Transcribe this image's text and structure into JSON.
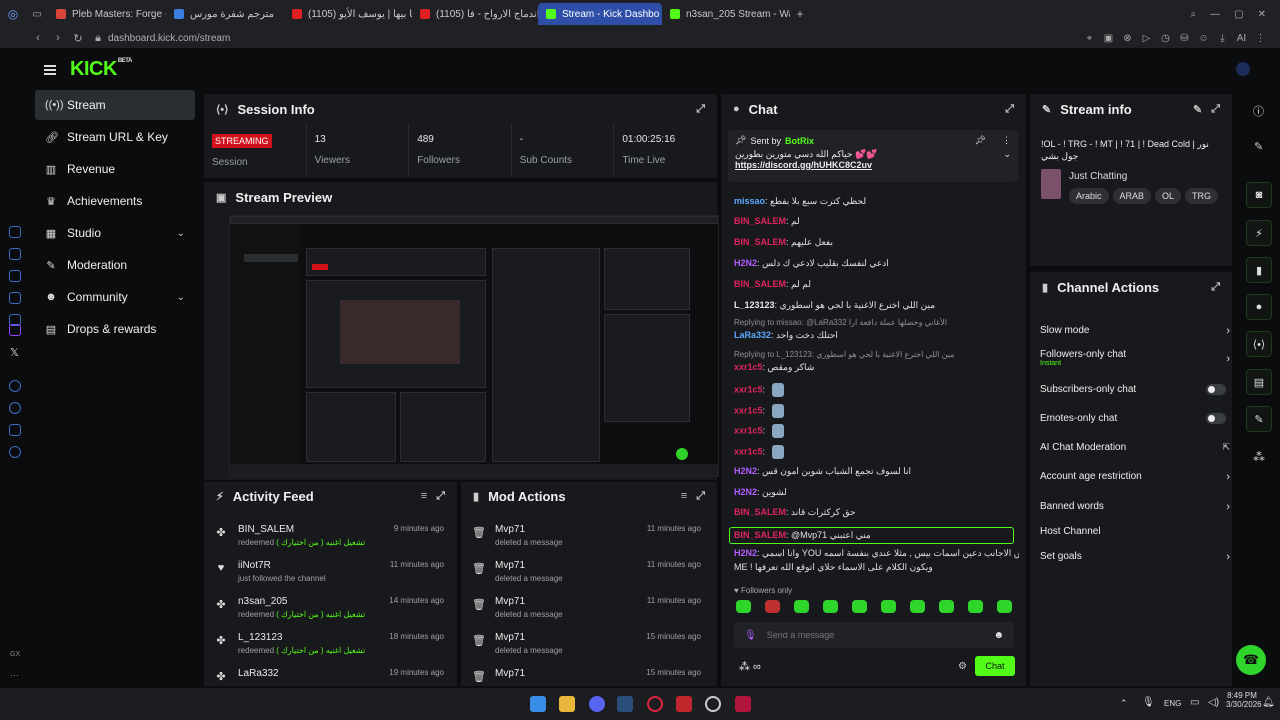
{
  "browser": {
    "tabs": [
      {
        "label": "Pleb Masters: Forge - GTA",
        "fav": "#d6453a"
      },
      {
        "label": "مترجم شفرة مورس",
        "fav": "#3b7de0"
      },
      {
        "label": "(1105) أرحتا بيها | يوسف الأيو...",
        "fav": "#e02020"
      },
      {
        "label": "(1105) اندماج الارواح - فا...",
        "fav": "#e02020"
      },
      {
        "label": "Stream - Kick Dashbo",
        "fav": "#53fc18"
      },
      {
        "label": "n3san_205 Stream - Watc",
        "fav": "#53fc18"
      }
    ],
    "url": "dashboard.kick.com/stream",
    "ai_label": "AI"
  },
  "brand": {
    "logo": "KICK",
    "beta": "BETA"
  },
  "sidebar": {
    "items": [
      {
        "label": "Stream",
        "icon": "broadcast-icon"
      },
      {
        "label": "Stream URL & Key",
        "icon": "link-icon"
      },
      {
        "label": "Revenue",
        "icon": "chart-icon"
      },
      {
        "label": "Achievements",
        "icon": "trophy-icon"
      },
      {
        "label": "Studio",
        "icon": "studio-icon"
      },
      {
        "label": "Moderation",
        "icon": "wrench-icon"
      },
      {
        "label": "Community",
        "icon": "people-icon"
      },
      {
        "label": "Drops & rewards",
        "icon": "gift-icon"
      }
    ]
  },
  "session": {
    "title": "Session Info",
    "status": "STREAMING",
    "status_label": "Session",
    "viewers": "13",
    "viewers_label": "Viewers",
    "followers": "489",
    "followers_label": "Followers",
    "subs": "-",
    "subs_label": "Sub Counts",
    "time": "01:00:25:16",
    "time_label": "Time Live"
  },
  "preview": {
    "title": "Stream Preview"
  },
  "activity": {
    "title": "Activity Feed",
    "rows": [
      {
        "name": "BIN_SALEM",
        "desc": "redeemed",
        "reward": "تشغيل اغنيه ( من اختيارك )",
        "time": "9 minutes ago"
      },
      {
        "name": "iiNot7R",
        "desc": "just followed the channel",
        "reward": "",
        "time": "11 minutes ago"
      },
      {
        "name": "n3san_205",
        "desc": "redeemed",
        "reward": "تشغيل اغنيه ( من اختيارك )",
        "time": "14 minutes ago"
      },
      {
        "name": "L_123123",
        "desc": "redeemed",
        "reward": "تشغيل اغنيه ( من اختيارك )",
        "time": "18 minutes ago"
      },
      {
        "name": "LaRa332",
        "desc": "",
        "reward": "",
        "time": "19 minutes ago"
      }
    ]
  },
  "mod": {
    "title": "Mod Actions",
    "rows": [
      {
        "name": "Mvp71",
        "desc": "deleted a message",
        "time": "11 minutes ago"
      },
      {
        "name": "Mvp71",
        "desc": "deleted a message",
        "time": "11 minutes ago"
      },
      {
        "name": "Mvp71",
        "desc": "deleted a message",
        "time": "11 minutes ago"
      },
      {
        "name": "Mvp71",
        "desc": "deleted a message",
        "time": "15 minutes ago"
      },
      {
        "name": "Mvp71",
        "desc": "",
        "time": "15 minutes ago"
      }
    ]
  },
  "chat": {
    "title": "Chat",
    "pinned_by": "Sent by",
    "pinned_user": "BotRix",
    "pinned_text": "حياكم الله دسي متورين بطورين 💕💕",
    "pinned_link": "https://discord.gg/hUHKC8C2uv",
    "messages": [
      {
        "user": "missao",
        "color": "#5aa9ff",
        "text": "لحظي كترت سبع بلا بفطع"
      },
      {
        "user": "BIN_SALEM",
        "color": "#e0245e",
        "text": "لم"
      },
      {
        "user": "BIN_SALEM",
        "color": "#e0245e",
        "text": "بفعل عليهم"
      },
      {
        "user": "H2N2",
        "color": "#b05cff",
        "text": "ادعي لنفسك بقليب لادعي ك دلس"
      },
      {
        "user": "BIN_SALEM",
        "color": "#e0245e",
        "text": "لم لم"
      },
      {
        "user": "L_123123",
        "color": "#e8e8e8",
        "text": "مين اللي اخترع الاغنية با لحي هو اسطوري"
      },
      {
        "reply": "Replying to missao: @LaRa332 الأغاني وخضلها عملة دافعة ارا"
      },
      {
        "user": "LaRa332",
        "color": "#5aa9ff",
        "text": "احتلك دخت واحد"
      },
      {
        "reply": "Replying to L_123123: مين اللي اخترع الاغنية با لحي هو اسطوري"
      },
      {
        "user": "xxr1c5",
        "color": "#e0245e",
        "text": "شاكر ومقص"
      },
      {
        "user": "xxr1c5",
        "color": "#e0245e",
        "text": ""
      },
      {
        "user": "xxr1c5",
        "color": "#e0245e",
        "text": ""
      },
      {
        "user": "xxr1c5",
        "color": "#e0245e",
        "text": ""
      },
      {
        "user": "xxr1c5",
        "color": "#e0245e",
        "text": ""
      },
      {
        "user": "H2N2",
        "color": "#b05cff",
        "text": "انا لسوف تجمع الشباب شوين امون قس"
      },
      {
        "user": "H2N2",
        "color": "#b05cff",
        "text": "لشوين"
      },
      {
        "user": "BIN_SALEM",
        "color": "#e0245e",
        "text": "حق كركثرات قاند"
      },
      {
        "user": "BIN_SALEM",
        "color": "#e0245e",
        "text": "@Mvp71 مني اعتبني"
      },
      {
        "user": "H2N2",
        "color": "#b05cff",
        "text": "وانا اسمي YOU شيون نفس الاجانب دعين اسمات بيس , مثلا عندي بنفسة اسمه"
      },
      {
        "user": "",
        "color": "#e8e8e8",
        "text": "ME ! ويكون الكلام على الاسماء حلاي اتوقع الله تعرفها"
      }
    ],
    "followers_only": "Followers only",
    "placeholder": "Send a message",
    "send": "Chat"
  },
  "stream_info": {
    "title": "Stream info",
    "stream_title": "!OL - ! TRG - ! MT | ! 71 | ! Dead Cold | نور جول بشي",
    "category": "Just Chatting",
    "tags": [
      "Arabic",
      "ARAB",
      "OL",
      "TRG"
    ]
  },
  "channel_actions": {
    "title": "Channel Actions",
    "items": [
      {
        "label": "Slow mode",
        "type": "chevron"
      },
      {
        "label": "Followers-only chat",
        "sub": "Instant",
        "type": "chevron"
      },
      {
        "label": "Subscribers-only chat",
        "type": "toggle"
      },
      {
        "label": "Emotes-only chat",
        "type": "toggle"
      },
      {
        "label": "AI Chat Moderation",
        "type": "external"
      },
      {
        "label": "Account age restriction",
        "type": "chevron"
      },
      {
        "label": "Banned words",
        "type": "chevron"
      },
      {
        "label": "Host Channel",
        "type": "none"
      },
      {
        "label": "Set goals",
        "type": "chevron"
      }
    ]
  },
  "taskbar": {
    "lang": "ENG",
    "time": "8:49 PM",
    "date": "3/30/2026"
  },
  "colors": {
    "accent": "#53fc18",
    "live": "#d0121b",
    "panel": "#18191c"
  }
}
